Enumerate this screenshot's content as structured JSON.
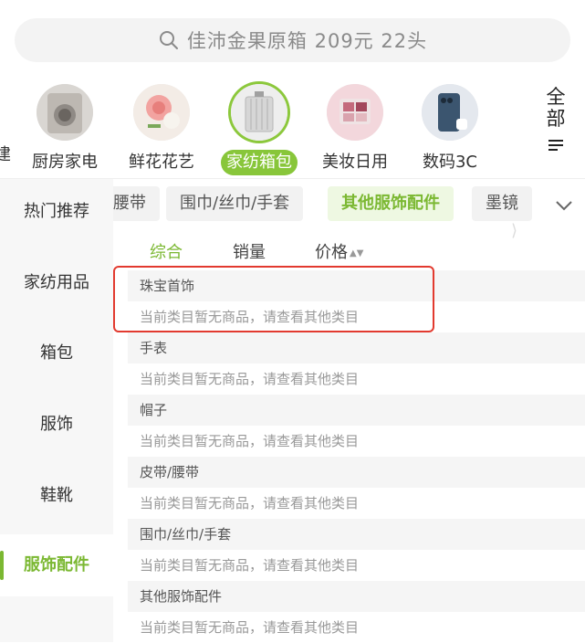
{
  "search": {
    "placeholder": "佳沛金果原箱 209元 22头"
  },
  "top_categories": [
    {
      "label": "厨房家电",
      "active": false
    },
    {
      "label": "鲜花花艺",
      "active": false
    },
    {
      "label": "家纺箱包",
      "active": true
    },
    {
      "label": "美妆日用",
      "active": false
    },
    {
      "label": "数码3C",
      "active": false
    }
  ],
  "edge_left_label": "建",
  "all_button": {
    "line1": "全",
    "line2": "部"
  },
  "sidebar": [
    {
      "label": "热门推荐",
      "active": false
    },
    {
      "label": "家纺用品",
      "active": false
    },
    {
      "label": "箱包",
      "active": false
    },
    {
      "label": "服饰",
      "active": false
    },
    {
      "label": "鞋靴",
      "active": false
    },
    {
      "label": "服饰配件",
      "active": true
    }
  ],
  "sub_chips": [
    {
      "label": "腰带",
      "selected": false
    },
    {
      "label": "围巾/丝巾/手套",
      "selected": false
    },
    {
      "label": "其他服饰配件",
      "selected": true
    },
    {
      "label": "墨镜",
      "selected": false
    }
  ],
  "sort": {
    "comprehensive": "综合",
    "sales": "销量",
    "price": "价格",
    "price_arrows": "▲▼"
  },
  "groups": [
    {
      "title": "珠宝首饰",
      "empty": "当前类目暂无商品，请查看其他类目"
    },
    {
      "title": "手表",
      "empty": "当前类目暂无商品，请查看其他类目"
    },
    {
      "title": "帽子",
      "empty": "当前类目暂无商品，请查看其他类目"
    },
    {
      "title": "皮带/腰带",
      "empty": "当前类目暂无商品，请查看其他类目"
    },
    {
      "title": "围巾/丝巾/手套",
      "empty": "当前类目暂无商品，请查看其他类目"
    },
    {
      "title": "其他服饰配件",
      "empty": "当前类目暂无商品，请查看其他类目"
    }
  ],
  "colors": {
    "accent": "#7bb832",
    "highlight": "#e23a2f"
  }
}
